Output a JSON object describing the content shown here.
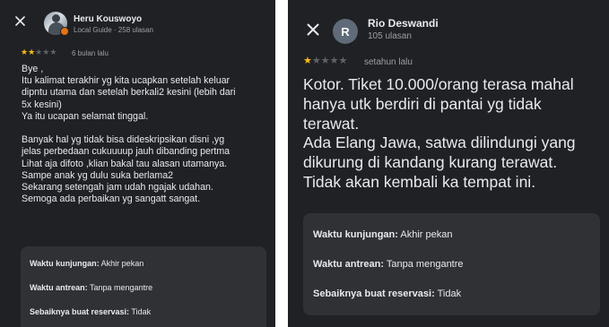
{
  "left": {
    "reviewer": {
      "name": "Heru Kouswoyo",
      "meta": "Local Guide · 258 ulasan",
      "avatar_type": "photo"
    },
    "rating": 2,
    "max_rating": 5,
    "time": "6 bulan lalu",
    "review_lines": [
      "Bye ,",
      "Itu kalimat terakhir yg kita ucapkan setelah keluar",
      "dipntu utama dan setelah berkali2 kesini (lebih dari",
      "5x kesini)",
      "Ya itu ucapan selamat tinggal.",
      "",
      "Banyak hal yg tidak bisa dideskripsikan disni ,yg",
      "jelas perbedaan cukuuuup jauh dibanding pertma",
      "Lihat aja difoto ,klian bakal tau alasan utamanya.",
      "Sampe anak yg dulu suka berlama2",
      "Sekarang setengah jam udah ngajak udahan.",
      "Semoga ada perbaikan yg sangatt sangat."
    ],
    "details": [
      {
        "label": "Waktu kunjungan:",
        "value": "Akhir pekan"
      },
      {
        "label": "Waktu antrean:",
        "value": "Tanpa mengantre"
      },
      {
        "label": "Sebaiknya buat reservasi:",
        "value": "Tidak"
      }
    ]
  },
  "right": {
    "reviewer": {
      "name": "Rio Deswandi",
      "meta": "105 ulasan",
      "avatar_letter": "R"
    },
    "rating": 1,
    "max_rating": 5,
    "time": "setahun lalu",
    "review_lines": [
      "Kotor. Tiket 10.000/orang terasa mahal",
      "hanya utk berdiri di pantai yg tidak",
      "terawat.",
      "Ada Elang Jawa, satwa dilindungi yang",
      "dikurung di kandang kurang terawat.",
      "Tidak akan kembali ka tempat ini."
    ],
    "details": [
      {
        "label": "Waktu kunjungan:",
        "value": "Akhir pekan"
      },
      {
        "label": "Waktu antrean:",
        "value": "Tanpa mengantre"
      },
      {
        "label": "Sebaiknya buat reservasi:",
        "value": "Tidak"
      }
    ]
  },
  "colors": {
    "background": "#202124",
    "card": "#303134",
    "text": "#e8eaed",
    "muted": "#9aa0a6",
    "star": "#fbbc04",
    "star_empty": "#5f6368",
    "local_guide_badge": "#e8710a"
  },
  "icons": {
    "close": "close-icon",
    "star": "star-icon",
    "local_guide": "local-guide-badge-icon"
  }
}
